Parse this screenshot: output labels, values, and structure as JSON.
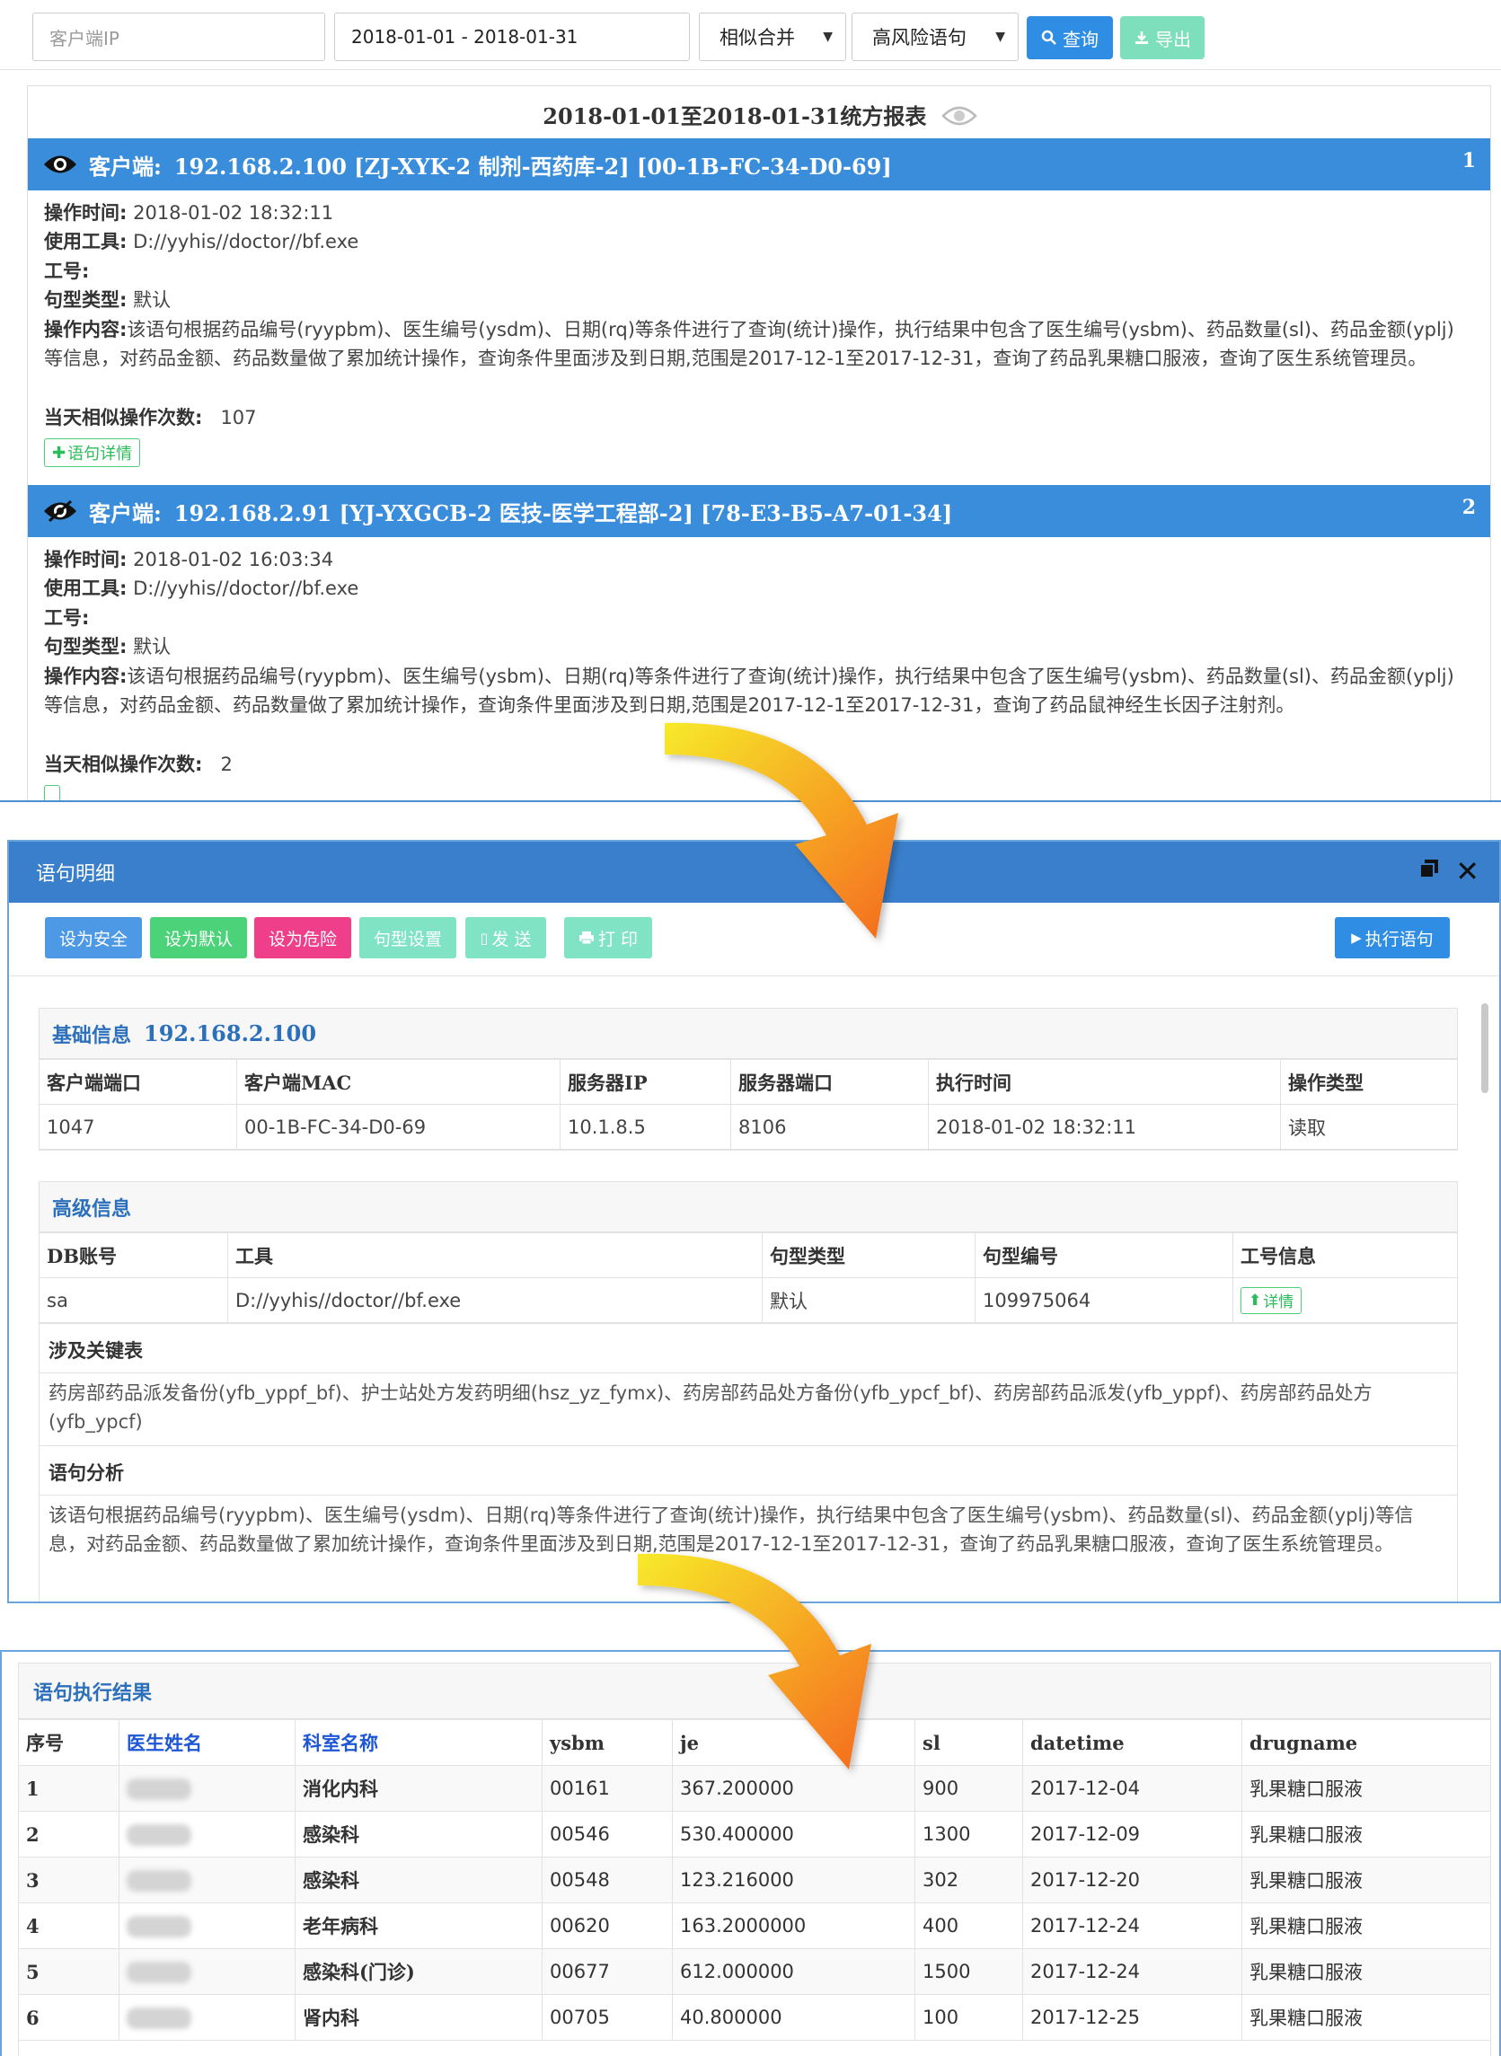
{
  "topbar": {
    "ip_placeholder": "客户端IP",
    "date_range": "2018-01-01 - 2018-01-31",
    "merge_select": "相似合并",
    "risk_select": "高风险语句",
    "query_label": "查询",
    "export_label": "导出"
  },
  "report": {
    "title": "2018-01-01至2018-01-31统方报表",
    "labels": {
      "client": "客户端:",
      "op_time": "操作时间:",
      "tool": "使用工具:",
      "job_no": "工号:",
      "sentence_type": "句型类型:",
      "op_content": "操作内容:",
      "similar_count": "当天相似操作次数:",
      "detail_btn": "语句详情"
    },
    "records": [
      {
        "index": "1",
        "client": "192.168.2.100  [ZJ-XYK-2 制剂-西药库-2]  [00-1B-FC-34-D0-69]",
        "op_time": "2018-01-02 18:32:11",
        "tool": "D://yyhis//doctor//bf.exe",
        "job_no": "",
        "sentence_type": "默认",
        "op_content": "该语句根据药品编号(ryypbm)、医生编号(ysdm)、日期(rq)等条件进行了查询(统计)操作，执行结果中包含了医生编号(ysbm)、药品数量(sl)、药品金额(yplj)等信息，对药品金额、药品数量做了累加统计操作，查询条件里面涉及到日期,范围是2017-12-1至2017-12-31，查询了药品乳果糖口服液，查询了医生系统管理员。",
        "similar_count": "107"
      },
      {
        "index": "2",
        "client": "192.168.2.91  [YJ-YXGCB-2 医技-医学工程部-2]  [78-E3-B5-A7-01-34]",
        "op_time": "2018-01-02 16:03:34",
        "tool": "D://yyhis//doctor//bf.exe",
        "job_no": "",
        "sentence_type": "默认",
        "op_content": "该语句根据药品编号(ryypbm)、医生编号(ysbm)、日期(rq)等条件进行了查询(统计)操作，执行结果中包含了医生编号(ysbm)、药品数量(sl)、药品金额(yplj)等信息，对药品金额、药品数量做了累加统计操作，查询条件里面涉及到日期,范围是2017-12-1至2017-12-31，查询了药品鼠神经生长因子注射剂。",
        "similar_count": "2"
      }
    ]
  },
  "detail": {
    "title": "语句明细",
    "buttons": {
      "safe": "设为安全",
      "default": "设为默认",
      "danger": "设为危险",
      "sentence_setting": "句型设置",
      "send": "发 送",
      "print": "打 印",
      "execute": "执行语句"
    },
    "basic": {
      "title": "基础信息",
      "ip": "192.168.2.100",
      "headers": [
        "客户端端口",
        "客户端MAC",
        "服务器IP",
        "服务器端口",
        "执行时间",
        "操作类型"
      ],
      "values": [
        "1047",
        "00-1B-FC-34-D0-69",
        "10.1.8.5",
        "8106",
        "2018-01-02 18:32:11",
        "读取"
      ]
    },
    "advanced": {
      "title": "高级信息",
      "headers": [
        "DB账号",
        "工具",
        "句型类型",
        "句型编号",
        "工号信息"
      ],
      "values": [
        "sa",
        "D://yyhis//doctor//bf.exe",
        "默认",
        "109975064"
      ],
      "detail_btn": "详情",
      "tables_label": "涉及关键表",
      "tables_text": "药房部药品派发备份(yfb_yppf_bf)、护士站处方发药明细(hsz_yz_fymx)、药房部药品处方备份(yfb_ypcf_bf)、药房部药品派发(yfb_yppf)、药房部药品处方(yfb_ypcf)",
      "analysis_label": "语句分析",
      "analysis_text": "该语句根据药品编号(ryypbm)、医生编号(ysdm)、日期(rq)等条件进行了查询(统计)操作，执行结果中包含了医生编号(ysbm)、药品数量(sl)、药品金额(yplj)等信息，对药品金额、药品数量做了累加统计操作，查询条件里面涉及到日期,范围是2017-12-1至2017-12-31，查询了药品乳果糖口服液，查询了医生系统管理员。"
    }
  },
  "result": {
    "title": "语句执行结果",
    "headers": [
      "序号",
      "医生姓名",
      "科室名称",
      "ysbm",
      "je",
      "sl",
      "datetime",
      "drugname"
    ],
    "rows": [
      [
        "1",
        "",
        "消化内科",
        "00161",
        "367.200000",
        "900",
        "2017-12-04",
        "乳果糖口服液"
      ],
      [
        "2",
        "",
        "感染科",
        "00546",
        "530.400000",
        "1300",
        "2017-12-09",
        "乳果糖口服液"
      ],
      [
        "3",
        "",
        "感染科",
        "00548",
        "123.216000",
        "302",
        "2017-12-20",
        "乳果糖口服液"
      ],
      [
        "4",
        "",
        "老年病科",
        "00620",
        "163.2000000",
        "400",
        "2017-12-24",
        "乳果糖口服液"
      ],
      [
        "5",
        "",
        "感染科(门诊)",
        "00677",
        "612.000000",
        "1500",
        "2017-12-24",
        "乳果糖口服液"
      ],
      [
        "6",
        "",
        "肾内科",
        "00705",
        "40.800000",
        "100",
        "2017-12-25",
        "乳果糖口服液"
      ]
    ]
  },
  "colors": {
    "primary_blue": "#3a8ddb",
    "header_blue": "#3a7fcc",
    "green": "#4cd37a",
    "pink": "#ef3e8a",
    "teal_light": "#7de2c2",
    "arrow_yellow": "#f5e12a",
    "arrow_orange": "#f5741e"
  }
}
